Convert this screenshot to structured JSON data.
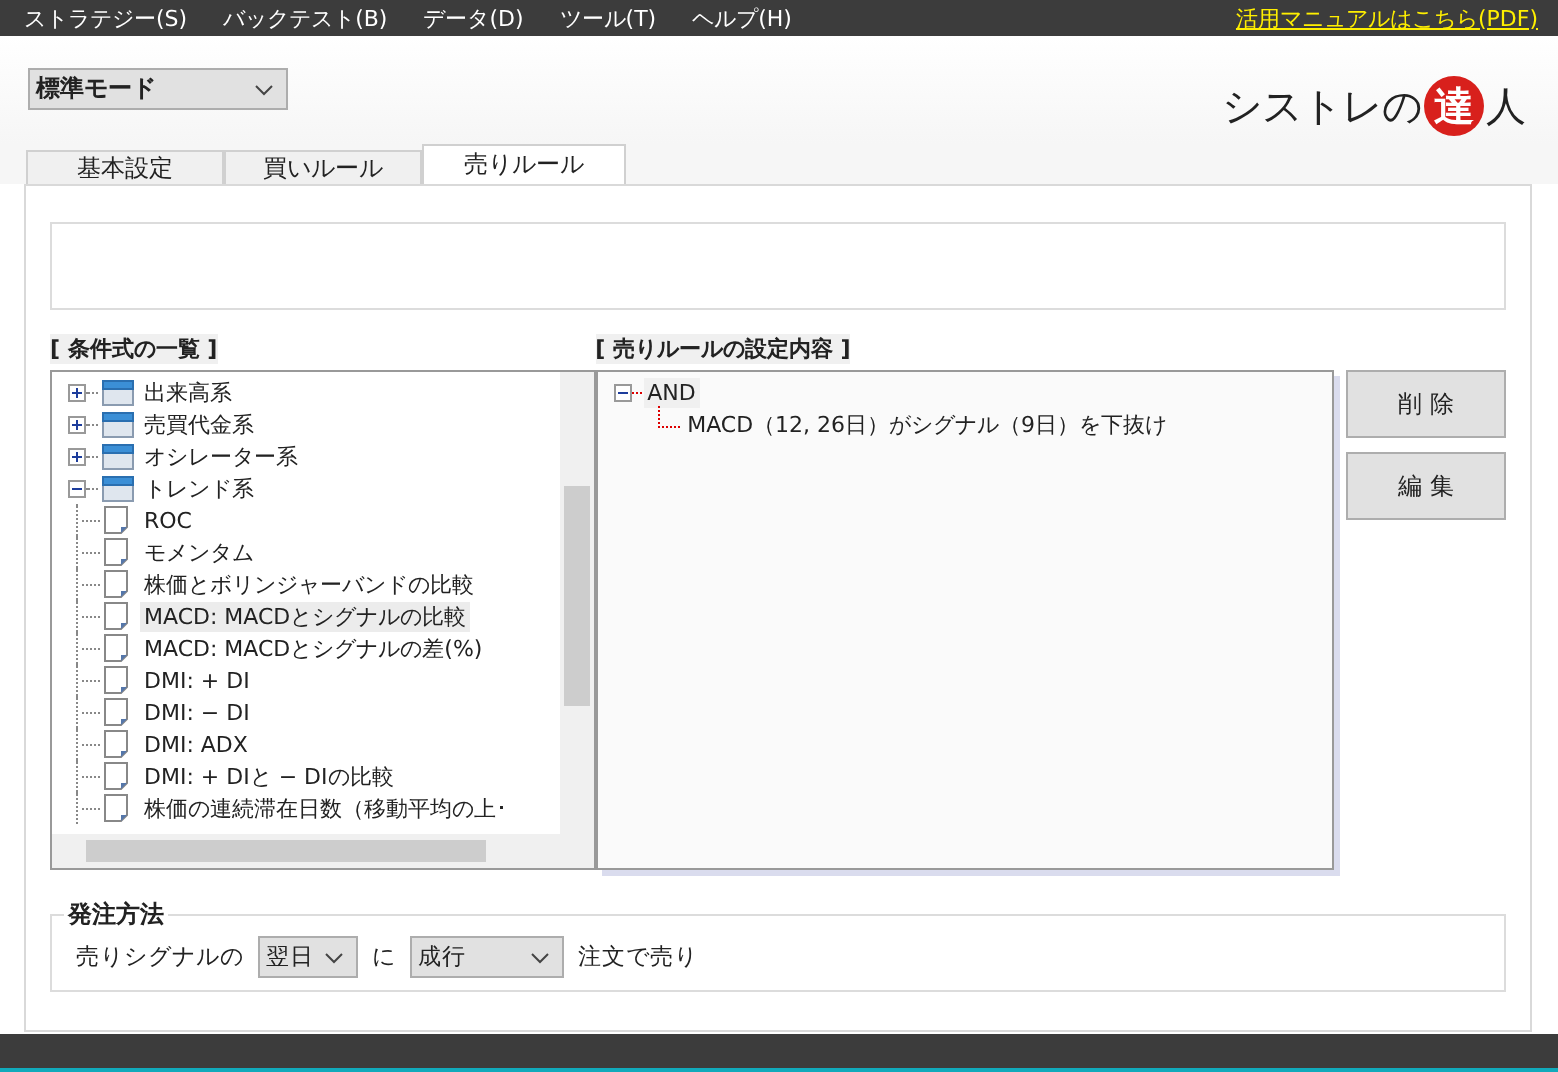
{
  "menu": [
    {
      "label": "ストラテジー(S)"
    },
    {
      "label": "バックテスト(B)"
    },
    {
      "label": "データ(D)"
    },
    {
      "label": "ツール(T)"
    },
    {
      "label": "ヘルプ(H)"
    }
  ],
  "manual_link": "活用マニュアルはこちら(PDF)",
  "mode_select": {
    "value": "標準モード"
  },
  "logo": {
    "text_before": "シストレの",
    "emblem": "達",
    "text_after": "人"
  },
  "tabs": [
    {
      "label": "基本設定",
      "selected": false
    },
    {
      "label": "買いルール",
      "selected": false
    },
    {
      "label": "売りルール",
      "selected": true
    }
  ],
  "condition_list": {
    "title": "[ 条件式の一覧 ]",
    "items": [
      {
        "label": "出来高系",
        "expanded": false
      },
      {
        "label": "売買代金系",
        "expanded": false
      },
      {
        "label": "オシレーター系",
        "expanded": false
      },
      {
        "label": "トレンド系",
        "expanded": true,
        "children": [
          {
            "label": "ROC",
            "selected": false
          },
          {
            "label": "モメンタム",
            "selected": false
          },
          {
            "label": "株価とボリンジャーバンドの比較",
            "selected": false
          },
          {
            "label": "MACD: MACDとシグナルの比較",
            "selected": true
          },
          {
            "label": "MACD: MACDとシグナルの差(%)",
            "selected": false
          },
          {
            "label": "DMI: + DI",
            "selected": false
          },
          {
            "label": "DMI: − DI",
            "selected": false
          },
          {
            "label": "DMI: ADX",
            "selected": false
          },
          {
            "label": "DMI: + DIと − DIの比較",
            "selected": false
          },
          {
            "label": "株価の連続滞在日数（移動平均の上･",
            "selected": false
          }
        ]
      }
    ]
  },
  "rule_settings": {
    "title": "[ 売りルールの設定内容 ]",
    "root": {
      "label": "AND",
      "expanded": true,
      "children": [
        {
          "label": "MACD（12, 26日）がシグナル（9日）を下抜け"
        }
      ]
    }
  },
  "buttons": [
    {
      "label": "削 除"
    },
    {
      "label": "編 集"
    }
  ],
  "order_method": {
    "title": "発注方法",
    "prefix": "売りシグナルの",
    "timing": "翌日",
    "connector": "に",
    "order_type": "成行",
    "suffix": "注文で売り"
  }
}
